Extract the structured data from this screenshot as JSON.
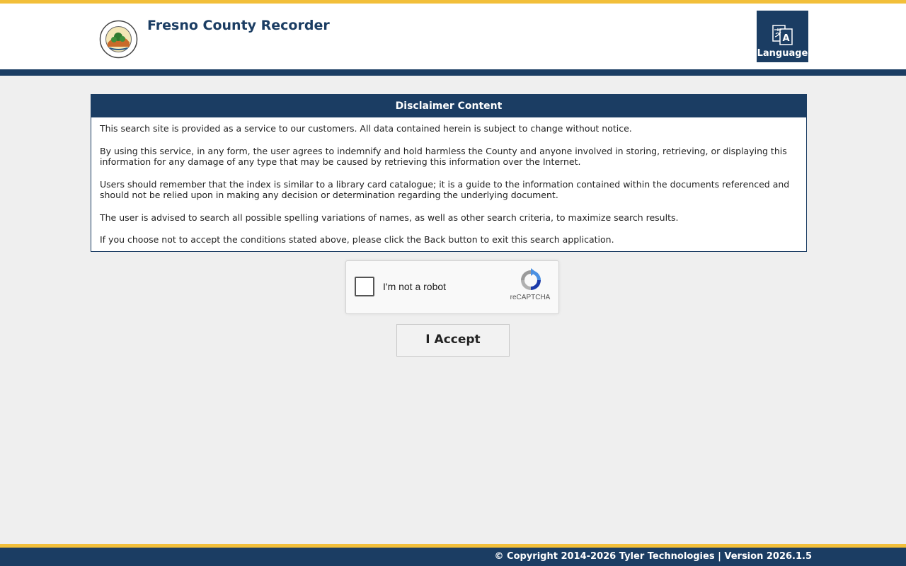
{
  "header": {
    "title": "Fresno County Recorder",
    "seal_icon": "county-seal-icon",
    "language_label": "Language",
    "language_icon": "translate-icon"
  },
  "disclaimer": {
    "heading": "Disclaimer Content",
    "paragraphs": [
      "This search site is provided as a service to our customers. All data contained herein is subject to change without notice.",
      "By using this service, in any form, the user agrees to indemnify and hold harmless the County and anyone involved in storing, retrieving, or displaying this information for any damage of any type that may be caused by retrieving this information over the Internet.",
      "Users should remember that the index is similar to a library card catalogue; it is a guide to the information contained within the documents referenced and should not be relied upon in making any decision or determination regarding the underlying document.",
      "The user is advised to search all possible spelling variations of names, as well as other search criteria, to maximize search results.",
      "If you choose not to accept the conditions stated above, please click the Back button to exit this search application."
    ]
  },
  "recaptcha": {
    "label": "I'm not a robot",
    "brand": "reCAPTCHA",
    "checked": false
  },
  "accept_label": "I Accept",
  "footer": {
    "copyright": "© Copyright 2014-2026 Tyler Technologies | Version 2026.1.5"
  },
  "colors": {
    "navy": "#1b3d63",
    "gold": "#f2bf3a",
    "background": "#efefef"
  }
}
